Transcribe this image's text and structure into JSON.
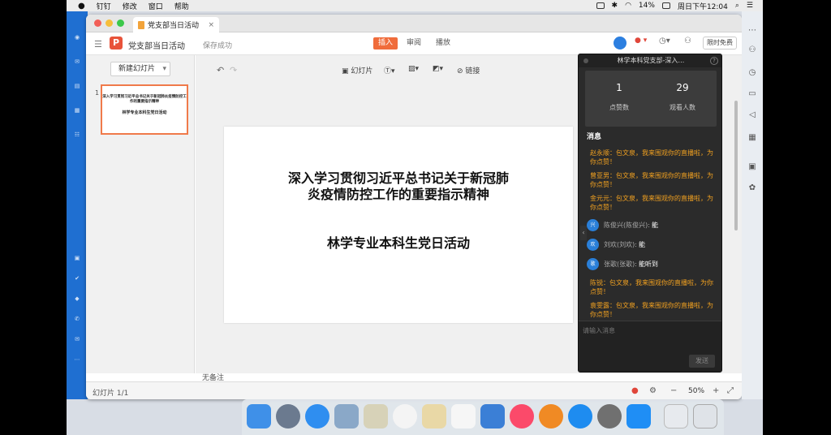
{
  "menubar": {
    "apple": "",
    "app": "钉钉",
    "menus": [
      "修改",
      "窗口",
      "帮助"
    ],
    "battery": "14%",
    "clock": "周日下午12:04"
  },
  "window": {
    "tab_title": "党支部当日活动",
    "tab_close": "×"
  },
  "toolbar": {
    "doc_title": "党支部当日活动",
    "saved": "保存成功",
    "tabs": [
      "插入",
      "审阅",
      "播放"
    ],
    "limited": "限时免费"
  },
  "thumbs": {
    "new_slide": "新建幻灯片",
    "slide_number": "1",
    "thumb_title": "深入学习贯彻习近平总书记关于新冠肺炎疫情防控工作的重要指示精神",
    "thumb_sub": "林学专业本科生党日活动"
  },
  "edit_toolbar": {
    "slides": "幻灯片",
    "link": "链接"
  },
  "slide": {
    "title_line1": "深入学习贯彻习近平总书记关于新冠肺",
    "title_line2": "炎疫情防控工作的重要指示精神",
    "subtitle": "林学专业本科生党日活动"
  },
  "notes": "无备注",
  "status": {
    "slide_count": "幻灯片 1/1",
    "zoom": "50%"
  },
  "chat": {
    "title": "林学本科党支部-深入…",
    "likes": "1",
    "likes_label": "点赞数",
    "viewers": "29",
    "viewers_label": "观看人数",
    "messages_label": "消息",
    "messages": [
      {
        "text": "赵永顺：包文泉，我来围观你的直播啦，为你点赞！"
      },
      {
        "text": "曾亚男：包文泉，我来围观你的直播啦，为你点赞！"
      },
      {
        "text": "金元元：包文泉，我来围观你的直播啦，为你点赞！"
      },
      {
        "avatar": "兴",
        "name": "陈俊兴(陈俊兴):",
        "text": "能"
      },
      {
        "avatar": "欢",
        "name": "刘欢(刘欢):",
        "text": "能"
      },
      {
        "avatar": "歌",
        "name": "张歌(张歌):",
        "text": "能听到"
      },
      {
        "text": "陈锐：包文泉，我来围观你的直播啦，为你点赞！"
      },
      {
        "text": "袁雯露：包文泉，我来围观你的直播啦，为你点赞！"
      }
    ],
    "placeholder": "请输入消息",
    "send": "发送"
  },
  "colors": {
    "accent": "#f06c3b",
    "sidebar": "#1f6fd1",
    "chat_highlight": "#f0a020"
  }
}
